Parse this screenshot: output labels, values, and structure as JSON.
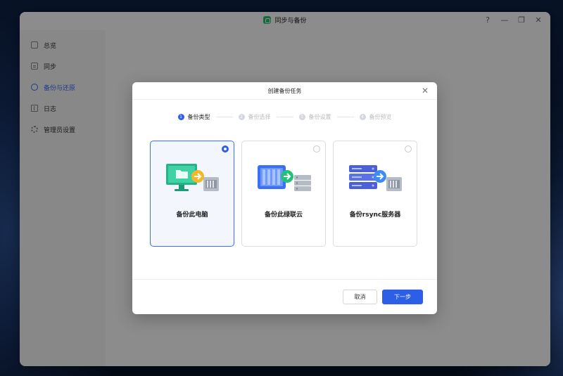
{
  "window": {
    "title": "同步与备份",
    "controls": [
      "?",
      "—",
      "❐",
      "✕"
    ]
  },
  "sidebar": {
    "items": [
      {
        "label": "总览",
        "icon": "overview-icon",
        "active": false
      },
      {
        "label": "同步",
        "icon": "sync-icon",
        "active": false
      },
      {
        "label": "备份与还原",
        "icon": "backup-icon",
        "active": true
      },
      {
        "label": "日志",
        "icon": "log-icon",
        "active": false
      },
      {
        "label": "管理员设置",
        "icon": "gear-icon",
        "active": false
      }
    ]
  },
  "dialog": {
    "title": "创建备份任务",
    "close": "✕",
    "steps": [
      {
        "num": "1",
        "label": "备份类型",
        "active": true
      },
      {
        "num": "2",
        "label": "备份选择",
        "active": false
      },
      {
        "num": "3",
        "label": "备份设置",
        "active": false
      },
      {
        "num": "4",
        "label": "备份预览",
        "active": false
      }
    ],
    "cards": [
      {
        "label": "备份此电脑",
        "selected": true
      },
      {
        "label": "备份此绿联云",
        "selected": false
      },
      {
        "label": "备份rsync服务器",
        "selected": false
      }
    ],
    "cancel_label": "取消",
    "next_label": "下一步"
  },
  "colors": {
    "accent": "#2c5fe6",
    "app_icon": "#1fc46d",
    "arrow_green": "#27c07a",
    "arrow_yellow": "#f2b829"
  }
}
